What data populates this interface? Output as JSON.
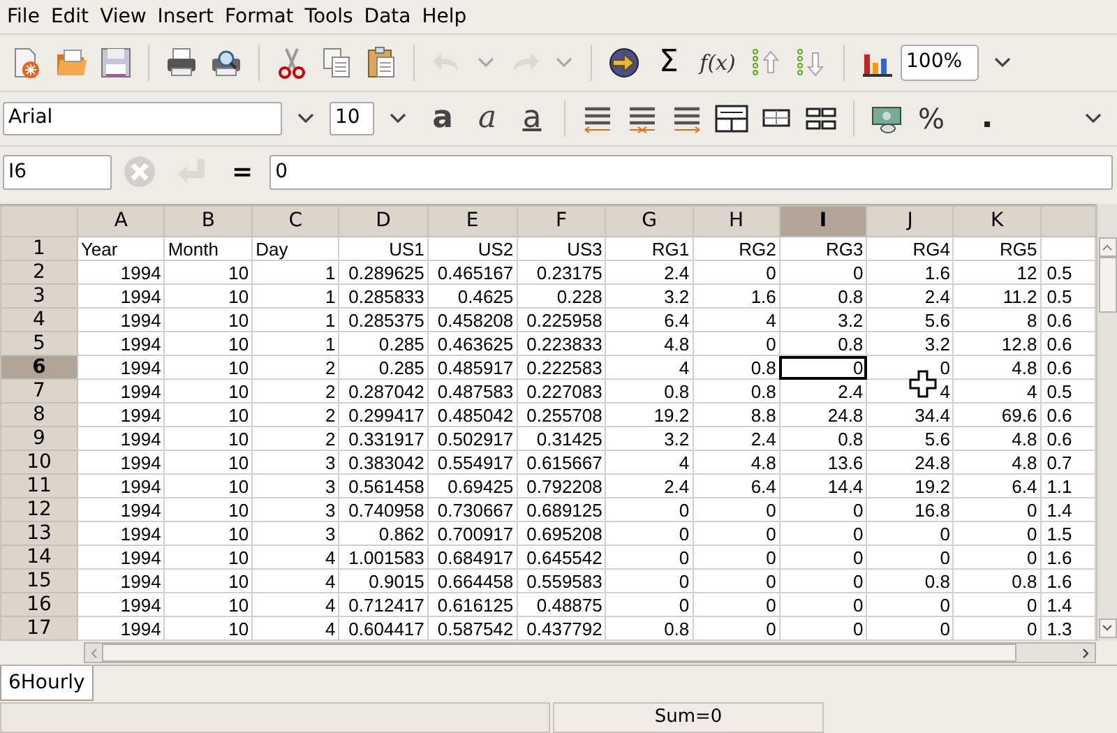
{
  "menu": [
    "File",
    "Edit",
    "View",
    "Insert",
    "Format",
    "Tools",
    "Data",
    "Help"
  ],
  "toolbar": {
    "sum_symbol": "Σ",
    "function_label": "f(x)",
    "zoom": "100%"
  },
  "format_bar": {
    "font": "Arial",
    "size": "10",
    "styles": [
      {
        "kind": "bold",
        "label": "a"
      },
      {
        "kind": "italic",
        "label": "a"
      },
      {
        "kind": "underline",
        "label": "a"
      }
    ],
    "percent_label": "%"
  },
  "formula_bar": {
    "cell_ref": "I6",
    "equals": "=",
    "formula": "0"
  },
  "sheet": {
    "columns": [
      {
        "label": "A",
        "selected": false
      },
      {
        "label": "B",
        "selected": false
      },
      {
        "label": "C",
        "selected": false
      },
      {
        "label": "D",
        "selected": false
      },
      {
        "label": "E",
        "selected": false
      },
      {
        "label": "F",
        "selected": false
      },
      {
        "label": "G",
        "selected": false
      },
      {
        "label": "H",
        "selected": false
      },
      {
        "label": "I",
        "selected": true
      },
      {
        "label": "J",
        "selected": false
      },
      {
        "label": "K",
        "selected": false
      },
      {
        "selected": false
      }
    ],
    "rows": [
      {
        "header": "1",
        "selected": false,
        "cells": [
          {
            "text": "Year",
            "align_left": true
          },
          {
            "text": "Month",
            "align_left": true
          },
          {
            "text": "Day",
            "align_left": true
          },
          {
            "text": "US1",
            "align_left": false
          },
          {
            "text": "US2",
            "align_left": false
          },
          {
            "text": "US3",
            "align_left": false
          },
          {
            "text": "RG1",
            "align_left": false
          },
          {
            "text": "RG2",
            "align_left": false
          },
          {
            "text": "RG3",
            "align_left": false
          },
          {
            "text": "RG4",
            "align_left": false
          },
          {
            "text": "RG5",
            "align_left": false
          }
        ]
      },
      {
        "header": "2",
        "selected": false,
        "cells": [
          "1994",
          "10",
          "1",
          "0.289625",
          "0.465167",
          "0.23175",
          "2.4",
          "0",
          "0",
          "1.6",
          "12",
          "0.5"
        ]
      },
      {
        "header": "3",
        "selected": false,
        "cells": [
          "1994",
          "10",
          "1",
          "0.285833",
          "0.4625",
          "0.228",
          "3.2",
          "1.6",
          "0.8",
          "2.4",
          "11.2",
          "0.5"
        ]
      },
      {
        "header": "4",
        "selected": false,
        "cells": [
          "1994",
          "10",
          "1",
          "0.285375",
          "0.458208",
          "0.225958",
          "6.4",
          "4",
          "3.2",
          "5.6",
          "8",
          "0.6"
        ]
      },
      {
        "header": "5",
        "selected": false,
        "cells": [
          "1994",
          "10",
          "1",
          "0.285",
          "0.463625",
          "0.223833",
          "4.8",
          "0",
          "0.8",
          "3.2",
          "12.8",
          "0.6"
        ]
      },
      {
        "header": "6",
        "selected": true,
        "cells": [
          "1994",
          "10",
          "2",
          "0.285",
          "0.485917",
          "0.222583",
          "4",
          "0.8",
          "0",
          "0",
          "4.8",
          "0.6"
        ]
      },
      {
        "header": "7",
        "selected": false,
        "cells": [
          "1994",
          "10",
          "2",
          "0.287042",
          "0.487583",
          "0.227083",
          "0.8",
          "0.8",
          "2.4",
          "4",
          "4",
          "0.5"
        ]
      },
      {
        "header": "8",
        "selected": false,
        "cells": [
          "1994",
          "10",
          "2",
          "0.299417",
          "0.485042",
          "0.255708",
          "19.2",
          "8.8",
          "24.8",
          "34.4",
          "69.6",
          "0.6"
        ]
      },
      {
        "header": "9",
        "selected": false,
        "cells": [
          "1994",
          "10",
          "2",
          "0.331917",
          "0.502917",
          "0.31425",
          "3.2",
          "2.4",
          "0.8",
          "5.6",
          "4.8",
          "0.6"
        ]
      },
      {
        "header": "10",
        "selected": false,
        "cells": [
          "1994",
          "10",
          "3",
          "0.383042",
          "0.554917",
          "0.615667",
          "4",
          "4.8",
          "13.6",
          "24.8",
          "4.8",
          "0.7"
        ]
      },
      {
        "header": "11",
        "selected": false,
        "cells": [
          "1994",
          "10",
          "3",
          "0.561458",
          "0.69425",
          "0.792208",
          "2.4",
          "6.4",
          "14.4",
          "19.2",
          "6.4",
          "1.1"
        ]
      },
      {
        "header": "12",
        "selected": false,
        "cells": [
          "1994",
          "10",
          "3",
          "0.740958",
          "0.730667",
          "0.689125",
          "0",
          "0",
          "0",
          "16.8",
          "0",
          "1.4"
        ]
      },
      {
        "header": "13",
        "selected": false,
        "cells": [
          "1994",
          "10",
          "3",
          "0.862",
          "0.700917",
          "0.695208",
          "0",
          "0",
          "0",
          "0",
          "0",
          "1.5"
        ]
      },
      {
        "header": "14",
        "selected": false,
        "cells": [
          "1994",
          "10",
          "4",
          "1.001583",
          "0.684917",
          "0.645542",
          "0",
          "0",
          "0",
          "0",
          "0",
          "1.6"
        ]
      },
      {
        "header": "15",
        "selected": false,
        "cells": [
          "1994",
          "10",
          "4",
          "0.9015",
          "0.664458",
          "0.559583",
          "0",
          "0",
          "0",
          "0.8",
          "0.8",
          "1.6"
        ]
      },
      {
        "header": "16",
        "selected": false,
        "cells": [
          "1994",
          "10",
          "4",
          "0.712417",
          "0.616125",
          "0.48875",
          "0",
          "0",
          "0",
          "0",
          "0",
          "1.4"
        ]
      },
      {
        "header": "17",
        "selected": false,
        "cells": [
          "1994",
          "10",
          "4",
          "0.604417",
          "0.587542",
          "0.437792",
          "0.8",
          "0",
          "0",
          "0",
          "0",
          "1.3"
        ]
      }
    ]
  },
  "sheet_tabs": [
    {
      "label": "6Hourly",
      "selected": true
    }
  ],
  "status_bar": {
    "sum": "Sum=0"
  }
}
